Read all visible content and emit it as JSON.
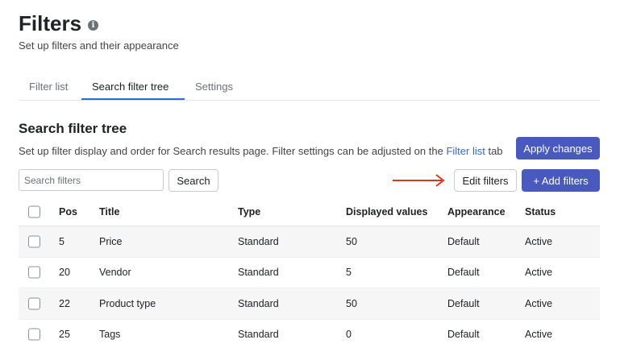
{
  "header": {
    "title": "Filters",
    "info_icon": "info-circle-icon",
    "subtitle": "Set up filters and their appearance"
  },
  "tabs": [
    {
      "label": "Filter list",
      "active": false
    },
    {
      "label": "Search filter tree",
      "active": true
    },
    {
      "label": "Settings",
      "active": false
    }
  ],
  "section": {
    "title": "Search filter tree",
    "description_prefix": "Set up filter display and order for Search results page. Filter settings can be adjusted on the",
    "description_link": "Filter list",
    "description_suffix": "tab"
  },
  "toolbar": {
    "apply_label": "Apply changes",
    "search_placeholder": "Search filters",
    "search_label": "Search",
    "edit_label": "Edit filters",
    "add_label": "+ Add filters",
    "annotation_arrow_color": "#d93a1f"
  },
  "table": {
    "headers": {
      "pos": "Pos",
      "title": "Title",
      "type": "Type",
      "displayed": "Displayed values",
      "appearance": "Appearance",
      "status": "Status"
    },
    "rows": [
      {
        "pos": "5",
        "title": "Price",
        "type": "Standard",
        "displayed": "50",
        "appearance": "Default",
        "status": "Active"
      },
      {
        "pos": "20",
        "title": "Vendor",
        "type": "Standard",
        "displayed": "5",
        "appearance": "Default",
        "status": "Active"
      },
      {
        "pos": "22",
        "title": "Product type",
        "type": "Standard",
        "displayed": "50",
        "appearance": "Default",
        "status": "Active"
      },
      {
        "pos": "25",
        "title": "Tags",
        "type": "Standard",
        "displayed": "0",
        "appearance": "Default",
        "status": "Active"
      }
    ]
  },
  "colors": {
    "primary_button": "#4959bd",
    "link": "#2c6ecb",
    "tab_underline": "#2c6ecb"
  }
}
